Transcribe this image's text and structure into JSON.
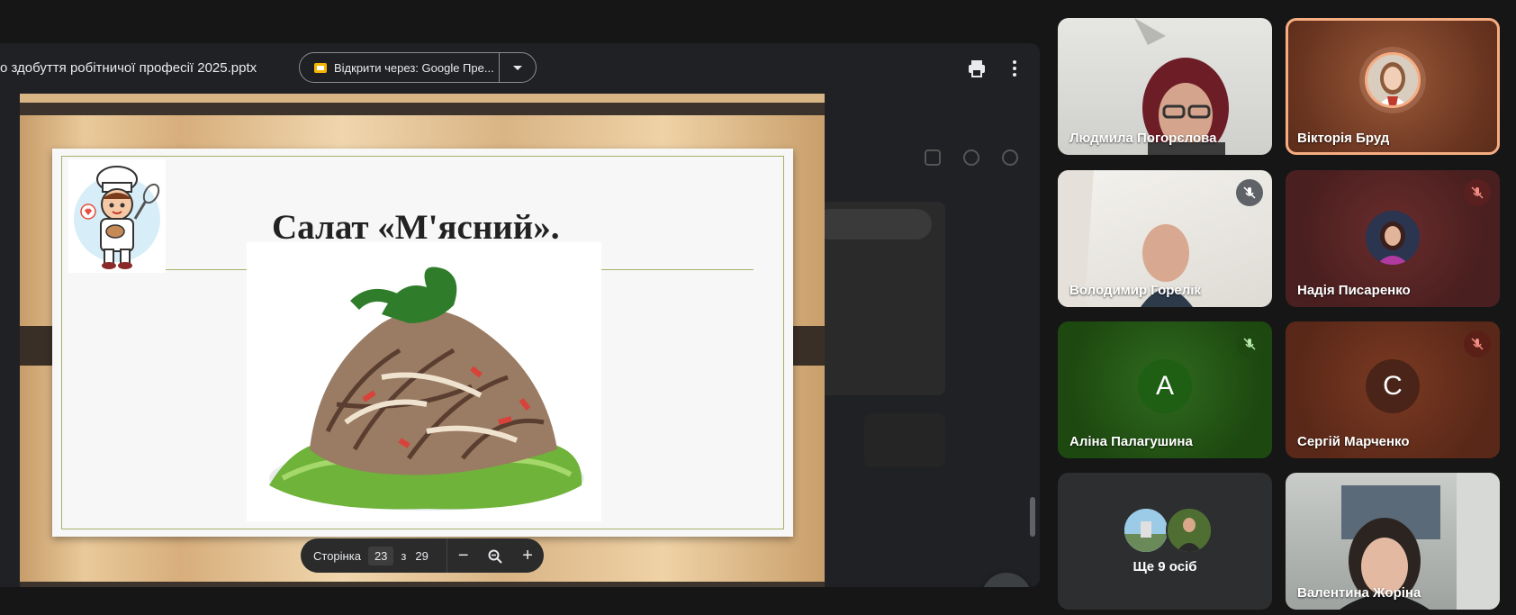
{
  "viewer": {
    "file_title": "о здобуття робітничої професії 2025.pptx",
    "open_with_label": "Відкрити через: Google Пре...",
    "print_icon": "print-icon",
    "more_icon": "more-vert-icon"
  },
  "slide": {
    "title": "Салат «М'ясний».",
    "image_subject": "salad"
  },
  "page_controls": {
    "label": "Сторінка",
    "current": "23",
    "of": "з",
    "total": "29",
    "zoom_out": "−",
    "zoom_in": "+"
  },
  "participants": [
    {
      "name": "Людмила Погорєлова",
      "muted": false,
      "type": "video"
    },
    {
      "name": "Вікторія Бруд",
      "muted": false,
      "type": "avatar",
      "speaking": true
    },
    {
      "name": "Володимир Горелік",
      "muted": true,
      "type": "video"
    },
    {
      "name": "Надія Писаренко",
      "muted": true,
      "type": "avatar"
    },
    {
      "name": "Аліна Палагушина",
      "muted": true,
      "type": "letter",
      "letter": "А",
      "color": "#1e5f14"
    },
    {
      "name": "Сергій Марченко",
      "muted": true,
      "type": "letter",
      "letter": "С",
      "color": "#5a2a1a"
    },
    {
      "name": "Ще 9 осіб",
      "type": "more"
    },
    {
      "name": "Валентина Жоріна",
      "muted": false,
      "type": "video"
    }
  ],
  "colors": {
    "accent_speaking": "#f6ad82",
    "background": "#161616"
  }
}
